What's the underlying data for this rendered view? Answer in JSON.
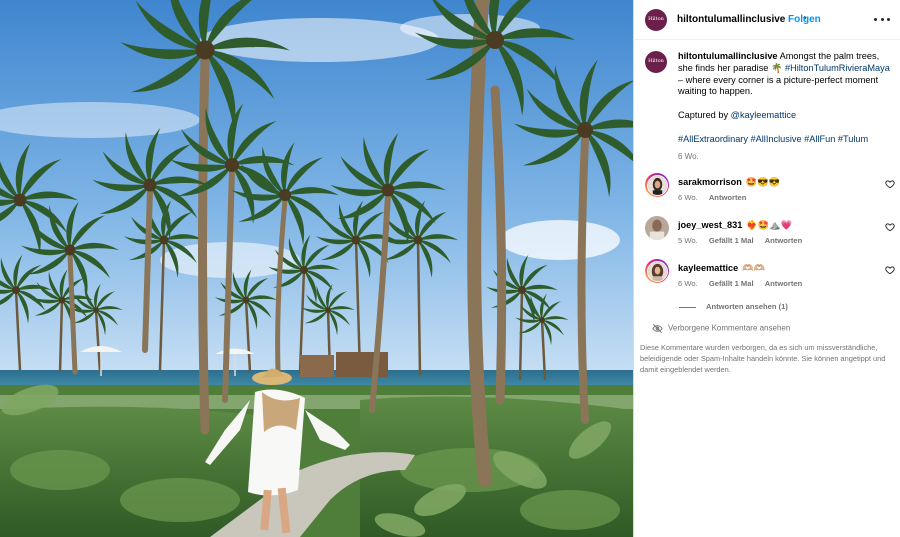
{
  "post": {
    "username": "hiltontulumallinclusive",
    "separator": "•",
    "follow_label": "Folgen",
    "brand_avatar_text": "Hilton",
    "caption": {
      "username": "hiltontulumallinclusive",
      "text_1": "Amongst the palm trees, she finds her paradise 🌴",
      "hashtag_1": "#HiltonTulumRivieraMaya",
      "text_2": "– where every corner is a picture-perfect moment waiting to happen.",
      "captured_by": "Captured by",
      "mention": "@kayleemattice",
      "hashtags": [
        "#AllExtraordinary",
        "#AllInclusive",
        "#AllFun",
        "#Tulum"
      ],
      "age": "6 Wo."
    }
  },
  "comments": [
    {
      "username": "sarakmorrison",
      "text": "🤩😎😎",
      "age": "6 Wo.",
      "likes": "",
      "reply_label": "Antworten"
    },
    {
      "username": "joey_west_831",
      "text": "❤️‍🔥🤩⛰️💗",
      "age": "5 Wo.",
      "likes": "Gefällt 1 Mal",
      "reply_label": "Antworten"
    },
    {
      "username": "kayleemattice",
      "text": "🫶🏼🫶🏼",
      "age": "6 Wo.",
      "likes": "Gefällt 1 Mal",
      "reply_label": "Antworten"
    }
  ],
  "view_replies_label": "Antworten ansehen (1)",
  "hidden_comments_label": "Verborgene Kommentare ansehen",
  "hidden_comments_note": "Diese Kommentare wurden verborgen, da es sich um missverständliche, beleidigende oder Spam-Inhalte handeln könnte. Sie können angetippt und damit eingeblendet werden.",
  "colors": {
    "accent": "#0095f6",
    "link": "#00376b",
    "muted": "#737373",
    "brand": "#6b1f4a"
  },
  "icons": {
    "more": "more-horizontal-icon",
    "like": "heart-outline-icon",
    "hidden": "eye-off-icon"
  }
}
